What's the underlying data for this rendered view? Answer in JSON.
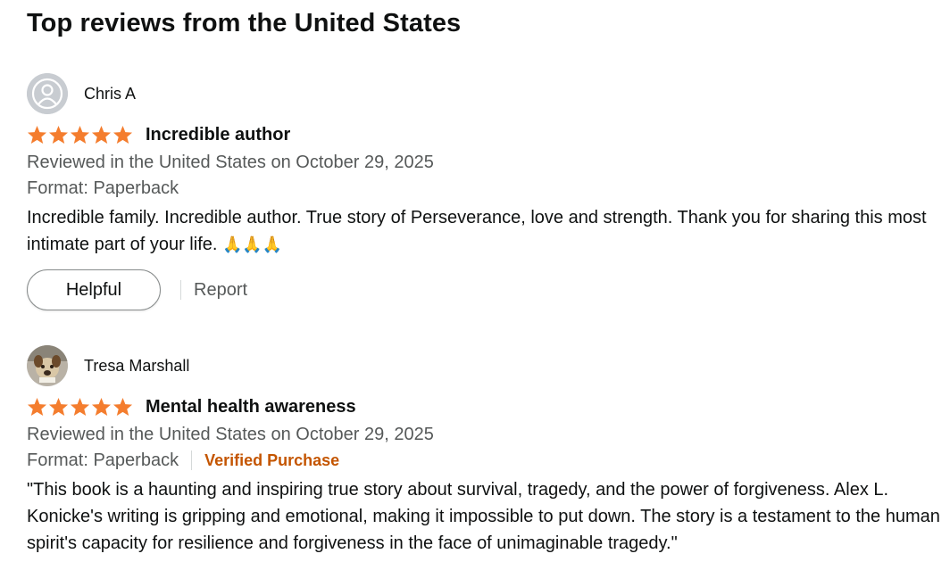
{
  "section": {
    "heading": "Top reviews from the United States"
  },
  "colors": {
    "star": "#f47d2e",
    "verified": "#c45500",
    "meta": "#565959"
  },
  "reviews": [
    {
      "author": "Chris A",
      "avatar_icon": "default-user-icon",
      "rating_stars": 5,
      "title": "Incredible author",
      "date_line": "Reviewed in the United States on October 29, 2025",
      "format": "Format: Paperback",
      "verified": "",
      "body": "Incredible family. Incredible author. True story of Perseverance, love and strength. Thank you for sharing this most intimate part of your life.",
      "emoji": "🙏🙏🙏",
      "helpful_label": "Helpful",
      "report_label": "Report"
    },
    {
      "author": "Tresa Marshall",
      "avatar_icon": "user-photo-icon",
      "rating_stars": 5,
      "title": "Mental health awareness",
      "date_line": "Reviewed in the United States on October 29, 2025",
      "format": "Format: Paperback",
      "verified": "Verified Purchase",
      "body": "\"This book is a haunting and inspiring true story about survival, tragedy, and the power of forgiveness. Alex L. Konicke's writing is gripping and emotional, making it impossible to put down. The story is a testament to the human spirit's capacity for resilience and forgiveness in the face of unimaginable tragedy.\""
    }
  ]
}
